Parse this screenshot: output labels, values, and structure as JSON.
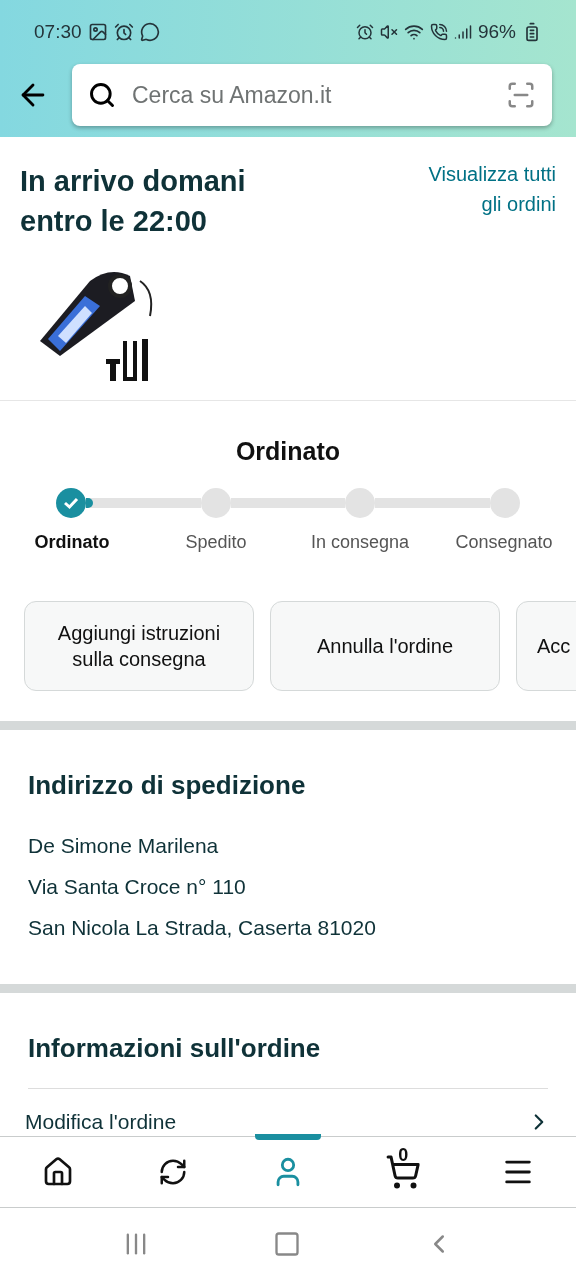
{
  "status_bar": {
    "time": "07:30",
    "battery": "96%"
  },
  "search": {
    "placeholder": "Cerca su Amazon.it"
  },
  "delivery": {
    "title": "In arrivo domani entro le 22:00",
    "link": "Visualizza tutti gli ordini"
  },
  "tracker": {
    "title": "Ordinato",
    "level": 0.05,
    "steps": [
      {
        "label": "Ordinato",
        "selected": true,
        "done": true
      },
      {
        "label": "Spedito",
        "selected": false,
        "done": false
      },
      {
        "label": "In consegna",
        "selected": false,
        "done": false
      },
      {
        "label": "Consegnato",
        "selected": false,
        "done": false
      }
    ]
  },
  "actions": [
    "Aggiungi istruzioni sulla consegna",
    "Annulla l'ordine",
    "Acc"
  ],
  "address": {
    "title": "Indirizzo di spedizione",
    "lines": [
      "De Simone Marilena",
      "Via Santa Croce n° 110",
      "San Nicola La Strada, Caserta 81020"
    ]
  },
  "order_info": {
    "title": "Informazioni sull'ordine",
    "items": [
      "Modifica l'ordine"
    ]
  },
  "bottom_nav": [
    {
      "kind": "home",
      "selected": false
    },
    {
      "kind": "reorder",
      "selected": false
    },
    {
      "kind": "account",
      "selected": true
    },
    {
      "kind": "cart",
      "selected": false,
      "count": "0"
    },
    {
      "kind": "menu",
      "selected": false
    }
  ]
}
